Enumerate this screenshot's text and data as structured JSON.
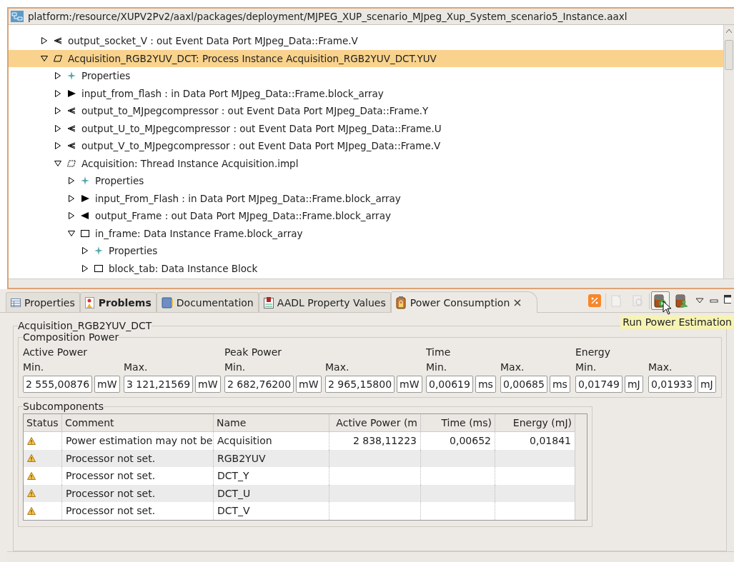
{
  "window": {
    "title": "platform:/resource/XUPV2Pv2/aaxl/packages/deployment/MJPEG_XUP_scenario_MJpeg_Xup_System_scenario5_Instance.aaxl"
  },
  "tree": [
    {
      "kind": "event-out",
      "label": "output_socket_V : out Event Data Port MJpeg_Data::Frame.V",
      "expanded": false,
      "selected": false
    },
    {
      "kind": "process",
      "label": "Acquisition_RGB2YUV_DCT: Process Instance Acquisition_RGB2YUV_DCT.YUV",
      "expanded": true,
      "selected": true,
      "children": [
        {
          "kind": "properties",
          "label": "Properties",
          "expanded": false,
          "selected": false
        },
        {
          "kind": "in",
          "label": "input_from_flash : in Data Port MJpeg_Data::Frame.block_array",
          "expanded": false,
          "selected": false
        },
        {
          "kind": "event-out",
          "label": "output_to_MJpegcompressor : out Event Data Port MJpeg_Data::Frame.Y",
          "expanded": false,
          "selected": false
        },
        {
          "kind": "event-out",
          "label": "output_U_to_MJpegcompressor : out Event Data Port MJpeg_Data::Frame.U",
          "expanded": false,
          "selected": false
        },
        {
          "kind": "event-out",
          "label": "output_V_to_MJpegcompressor : out Event Data Port MJpeg_Data::Frame.V",
          "expanded": false,
          "selected": false
        },
        {
          "kind": "thread",
          "label": "Acquisition: Thread Instance Acquisition.impl",
          "expanded": true,
          "selected": false,
          "children": [
            {
              "kind": "properties",
              "label": "Properties",
              "expanded": false,
              "selected": false
            },
            {
              "kind": "in",
              "label": "input_From_Flash : in Data Port MJpeg_Data::Frame.block_array",
              "expanded": false,
              "selected": false
            },
            {
              "kind": "out",
              "label": "output_Frame : out Data Port MJpeg_Data::Frame.block_array",
              "expanded": false,
              "selected": false
            },
            {
              "kind": "data",
              "label": "in_frame: Data Instance Frame.block_array",
              "expanded": true,
              "selected": false,
              "children": [
                {
                  "kind": "properties",
                  "label": "Properties",
                  "expanded": false,
                  "selected": false
                },
                {
                  "kind": "data",
                  "label": "block_tab: Data Instance Block",
                  "expanded": false,
                  "selected": false
                }
              ]
            }
          ]
        }
      ]
    }
  ],
  "tabs": [
    {
      "kind": "table",
      "label": "Properties",
      "selected": false,
      "highlighted": false
    },
    {
      "kind": "problems",
      "label": "Problems",
      "selected": false,
      "highlighted": true
    },
    {
      "kind": "book",
      "label": "Documentation",
      "selected": false,
      "highlighted": false
    },
    {
      "kind": "aadl",
      "label": "AADL Property Values",
      "selected": false,
      "highlighted": false
    },
    {
      "kind": "power",
      "label": "Power Consumption",
      "selected": true,
      "highlighted": false
    }
  ],
  "toolbar": [
    {
      "kind": "percent",
      "disabled": false,
      "pressed": false
    },
    {
      "kind": "new",
      "disabled": true,
      "pressed": false
    },
    {
      "kind": "refresh",
      "disabled": true,
      "pressed": false
    },
    {
      "kind": "run",
      "disabled": false,
      "pressed": true
    },
    {
      "kind": "user",
      "disabled": false,
      "pressed": false
    }
  ],
  "tooltip": "Run Power Estimation",
  "component": "Acquisition_RGB2YUV_DCT",
  "composition": {
    "title": "Composition Power",
    "groups": [
      {
        "label": "Active Power",
        "min_label": "Min.",
        "max_label": "Max.",
        "min": "2 555,00876",
        "max": "3 121,21569",
        "min_unit": "mW",
        "max_unit": "mW"
      },
      {
        "label": "Peak Power",
        "min_label": "Min.",
        "max_label": "Max.",
        "min": "2 682,76200",
        "max": "2 965,15800",
        "min_unit": "mW",
        "max_unit": "mW"
      },
      {
        "label": "Time",
        "min_label": "Min.",
        "max_label": "Max.",
        "min": "0,00619",
        "max": "0,00685",
        "min_unit": "ms",
        "max_unit": "ms"
      },
      {
        "label": "Energy",
        "min_label": "Min.",
        "max_label": "Max.",
        "min": "0,01749",
        "max": "0,01933",
        "min_unit": "mJ",
        "max_unit": "mJ"
      }
    ]
  },
  "subcomponents": {
    "title": "Subcomponents",
    "columns": [
      "Status",
      "Comment",
      "Name",
      "Active Power (m",
      "Time (ms)",
      "Energy (mJ)"
    ],
    "rows": [
      {
        "kind": "warning",
        "comment": "Power estimation may not be",
        "name": "Acquisition",
        "active_power": "2 838,11223",
        "time": "0,00652",
        "energy": "0,01841"
      },
      {
        "kind": "warning",
        "comment": "Processor not set.",
        "name": "RGB2YUV"
      },
      {
        "kind": "warning",
        "comment": "Processor not set.",
        "name": "DCT_Y"
      },
      {
        "kind": "warning",
        "comment": "Processor not set.",
        "name": "DCT_U"
      },
      {
        "kind": "warning",
        "comment": "Processor not set.",
        "name": "DCT_V"
      }
    ]
  }
}
